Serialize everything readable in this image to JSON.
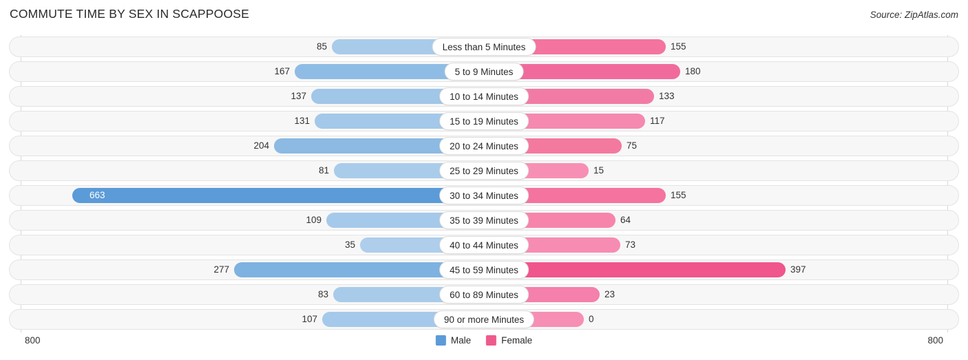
{
  "header": {
    "title": "COMMUTE TIME BY SEX IN SCAPPOOSE",
    "source": "Source: ZipAtlas.com"
  },
  "axis": {
    "left_tick": "800",
    "right_tick": "800"
  },
  "legend": {
    "items": [
      {
        "label": "Male",
        "color": "#5b9bd8"
      },
      {
        "label": "Female",
        "color": "#ef5a8c"
      }
    ]
  },
  "chart_data": {
    "type": "bar",
    "title": "COMMUTE TIME BY SEX IN SCAPPOOSE",
    "subtitle": "Source: ZipAtlas.com",
    "orientation": "horizontal-diverging",
    "xlabel": "",
    "ylabel": "",
    "xlim": [
      800,
      800
    ],
    "grid": false,
    "legend_position": "bottom-center",
    "categories": [
      "Less than 5 Minutes",
      "5 to 9 Minutes",
      "10 to 14 Minutes",
      "15 to 19 Minutes",
      "20 to 24 Minutes",
      "25 to 29 Minutes",
      "30 to 34 Minutes",
      "35 to 39 Minutes",
      "40 to 44 Minutes",
      "45 to 59 Minutes",
      "60 to 89 Minutes",
      "90 or more Minutes"
    ],
    "series": [
      {
        "name": "Male",
        "side": "left",
        "values": [
          85,
          167,
          137,
          131,
          204,
          81,
          663,
          109,
          35,
          277,
          83,
          107
        ]
      },
      {
        "name": "Female",
        "side": "right",
        "values": [
          155,
          180,
          133,
          117,
          75,
          15,
          155,
          64,
          73,
          397,
          23,
          0
        ]
      }
    ]
  },
  "rows": [
    {
      "category": "Less than 5 Minutes",
      "male": "85",
      "female": "155",
      "male_w": 208,
      "female_w": 251,
      "male_color": "#a8cbea",
      "female_color": "#f4739f",
      "male_inside": false
    },
    {
      "category": "5 to 9 Minutes",
      "male": "167",
      "female": "180",
      "male_w": 262,
      "female_w": 272,
      "male_color": "#8fbce4",
      "female_color": "#f06b9c",
      "male_inside": false
    },
    {
      "category": "10 to 14 Minutes",
      "male": "137",
      "female": "133",
      "male_w": 238,
      "female_w": 234,
      "male_color": "#a0c6e8",
      "female_color": "#f27ba6",
      "male_inside": false
    },
    {
      "category": "15 to 19 Minutes",
      "male": "131",
      "female": "117",
      "male_w": 233,
      "female_w": 221,
      "male_color": "#a3c8e9",
      "female_color": "#f589b0",
      "male_inside": false
    },
    {
      "category": "20 to 24 Minutes",
      "male": "204",
      "female": "75",
      "male_w": 292,
      "female_w": 187,
      "male_color": "#8cbae3",
      "female_color": "#f4799f",
      "male_inside": false
    },
    {
      "category": "25 to 29 Minutes",
      "male": "81",
      "female": "15",
      "male_w": 205,
      "female_w": 139,
      "male_color": "#a9cceb",
      "female_color": "#f78fb4",
      "male_inside": false
    },
    {
      "category": "30 to 34 Minutes",
      "male": "663",
      "female": "155",
      "male_w": 585,
      "female_w": 251,
      "male_color": "#5b9bd8",
      "female_color": "#f4739f",
      "male_inside": true
    },
    {
      "category": "35 to 39 Minutes",
      "male": "109",
      "female": "64",
      "male_w": 216,
      "female_w": 178,
      "male_color": "#a5c9ea",
      "female_color": "#f784ab",
      "male_inside": false
    },
    {
      "category": "40 to 44 Minutes",
      "male": "35",
      "female": "73",
      "male_w": 167,
      "female_w": 185,
      "male_color": "#aeceec",
      "female_color": "#f78cb2",
      "male_inside": false
    },
    {
      "category": "45 to 59 Minutes",
      "male": "277",
      "female": "397",
      "male_w": 350,
      "female_w": 425,
      "male_color": "#7eb2e0",
      "female_color": "#f0558b",
      "male_inside": false
    },
    {
      "category": "60 to 89 Minutes",
      "male": "83",
      "female": "23",
      "male_w": 206,
      "female_w": 155,
      "male_color": "#a8cbea",
      "female_color": "#f480ab",
      "male_inside": false
    },
    {
      "category": "90 or more Minutes",
      "male": "107",
      "female": "0",
      "male_w": 222,
      "female_w": 132,
      "male_color": "#a5c9ea",
      "female_color": "#f78fb4",
      "male_inside": false
    }
  ]
}
